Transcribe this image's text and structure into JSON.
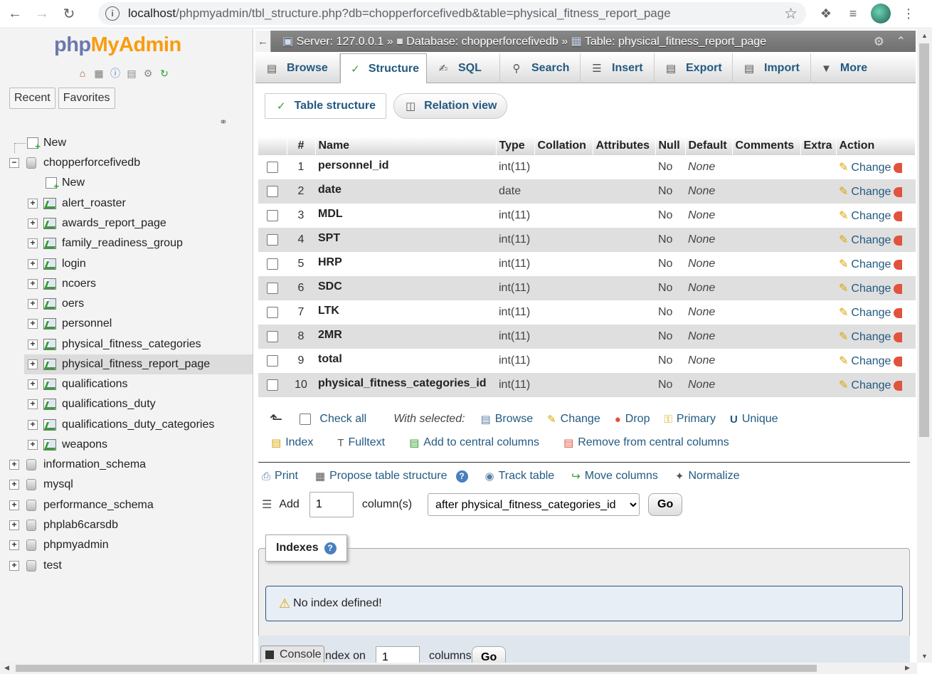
{
  "browser": {
    "url_host": "localhost",
    "url_path": "/phpmyadmin/tbl_structure.php?db=chopperforcefivedb&table=physical_fitness_report_page"
  },
  "sidebar": {
    "logo_php": "php",
    "logo_myadmin": "MyAdmin",
    "recent": "Recent",
    "favorites": "Favorites",
    "new_label": "New",
    "db_name": "chopperforcefivedb",
    "db_new_label": "New",
    "tables": [
      "alert_roaster",
      "awards_report_page",
      "family_readiness_group",
      "login",
      "ncoers",
      "oers",
      "personnel",
      "physical_fitness_categories",
      "physical_fitness_report_page",
      "qualifications",
      "qualifications_duty",
      "qualifications_duty_categories",
      "weapons"
    ],
    "other_dbs": [
      "information_schema",
      "mysql",
      "performance_schema",
      "phplab6carsdb",
      "phpmyadmin",
      "test"
    ]
  },
  "serverbar": {
    "server": "Server: 127.0.0.1",
    "database": "Database: chopperforcefivedb",
    "table": "Table: physical_fitness_report_page",
    "sep": "»"
  },
  "tabs": [
    "Browse",
    "Structure",
    "SQL",
    "Search",
    "Insert",
    "Export",
    "Import",
    "More"
  ],
  "subtabs": [
    "Table structure",
    "Relation view"
  ],
  "columns_header": [
    "#",
    "Name",
    "Type",
    "Collation",
    "Attributes",
    "Null",
    "Default",
    "Comments",
    "Extra",
    "Action"
  ],
  "rows": [
    {
      "n": "1",
      "name": "personnel_id",
      "type": "int(11)",
      "null": "No",
      "default": "None",
      "action": "Change"
    },
    {
      "n": "2",
      "name": "date",
      "type": "date",
      "null": "No",
      "default": "None",
      "action": "Change"
    },
    {
      "n": "3",
      "name": "MDL",
      "type": "int(11)",
      "null": "No",
      "default": "None",
      "action": "Change"
    },
    {
      "n": "4",
      "name": "SPT",
      "type": "int(11)",
      "null": "No",
      "default": "None",
      "action": "Change"
    },
    {
      "n": "5",
      "name": "HRP",
      "type": "int(11)",
      "null": "No",
      "default": "None",
      "action": "Change"
    },
    {
      "n": "6",
      "name": "SDC",
      "type": "int(11)",
      "null": "No",
      "default": "None",
      "action": "Change"
    },
    {
      "n": "7",
      "name": "LTK",
      "type": "int(11)",
      "null": "No",
      "default": "None",
      "action": "Change"
    },
    {
      "n": "8",
      "name": "2MR",
      "type": "int(11)",
      "null": "No",
      "default": "None",
      "action": "Change"
    },
    {
      "n": "9",
      "name": "total",
      "type": "int(11)",
      "null": "No",
      "default": "None",
      "action": "Change"
    },
    {
      "n": "10",
      "name": "physical_fitness_categories_id",
      "type": "int(11)",
      "null": "No",
      "default": "None",
      "action": "Change"
    }
  ],
  "bulk": {
    "check_all": "Check all",
    "with_selected": "With selected:",
    "browse": "Browse",
    "change": "Change",
    "drop": "Drop",
    "primary": "Primary",
    "unique": "Unique",
    "index": "Index",
    "fulltext": "Fulltext",
    "add_central": "Add to central columns",
    "remove_central": "Remove from central columns"
  },
  "tools": {
    "print": "Print",
    "propose": "Propose table structure",
    "track": "Track table",
    "move": "Move columns",
    "normalize": "Normalize"
  },
  "add_columns": {
    "label": "Add",
    "value": "1",
    "unit": "column(s)",
    "position": "after physical_fitness_categories_id",
    "go": "Go"
  },
  "indexes": {
    "legend": "Indexes",
    "message": "No index defined!",
    "create_prefix": "ndex on",
    "create_value": "1",
    "create_unit": "columns",
    "go": "Go"
  },
  "console": "Console"
}
